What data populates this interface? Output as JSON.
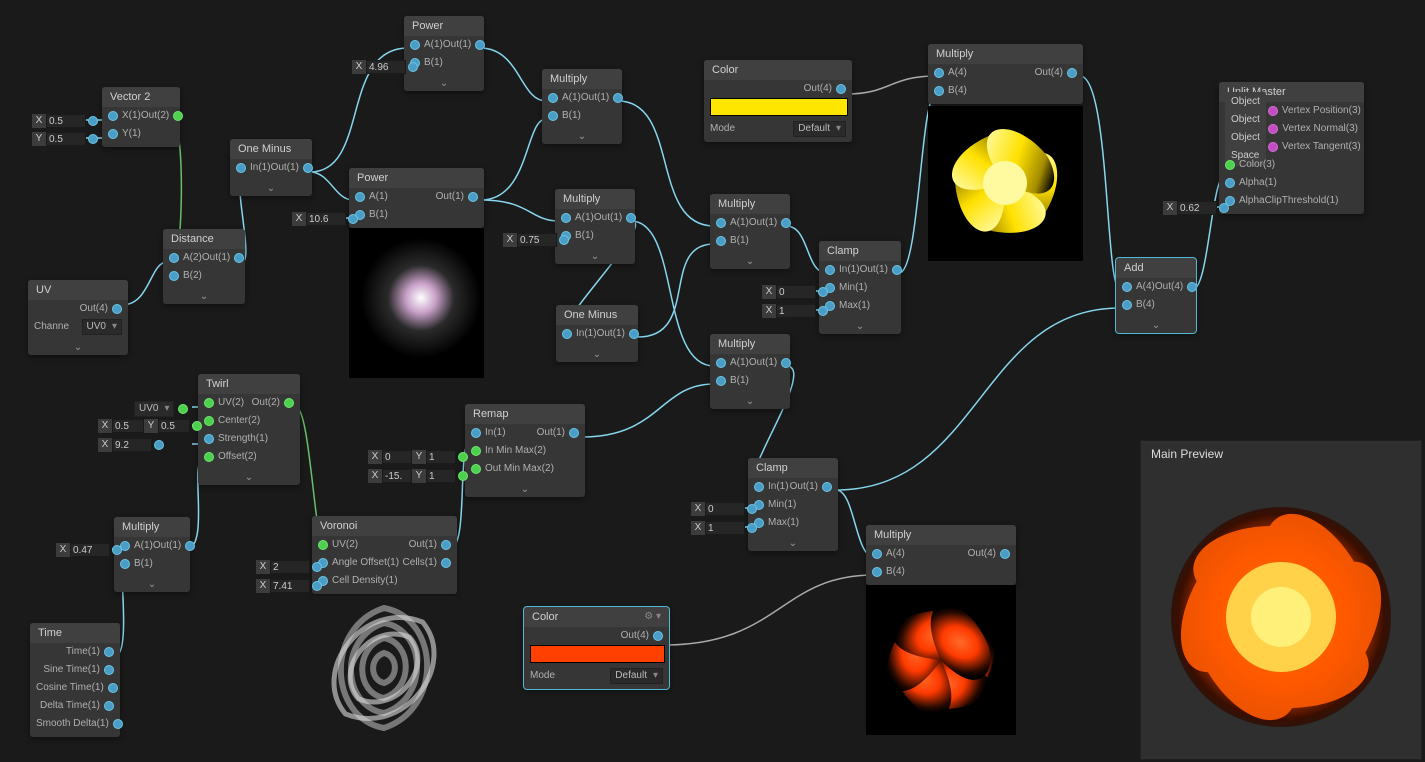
{
  "preview_title": "Main Preview",
  "master": {
    "title": "Unlit Master",
    "space": "Object Space",
    "ports": [
      "Vertex Position(3)",
      "Vertex Normal(3)",
      "Vertex Tangent(3)",
      "Color(3)",
      "Alpha(1)",
      "AlphaClipThreshold(1)"
    ],
    "alpha_x": "X",
    "alpha_val": "0.62"
  },
  "uv": {
    "title": "UV",
    "out": "Out(4)",
    "channel_lbl": "Channe",
    "channel": "UV0"
  },
  "vector2": {
    "title": "Vector 2",
    "x": "X(1)",
    "y": "Y(1)",
    "out": "Out(2)",
    "valx_lbl": "X",
    "valx": "0.5",
    "valy_lbl": "Y",
    "valy": "0.5"
  },
  "distance": {
    "title": "Distance",
    "a": "A(2)",
    "b": "B(2)",
    "out": "Out(1)"
  },
  "oneMinus": {
    "title": "One Minus",
    "in": "In(1)",
    "out": "Out(1)"
  },
  "power1": {
    "title": "Power",
    "a": "A(1)",
    "b": "B(1)",
    "out": "Out(1)",
    "bx": "X",
    "bval": "4.96"
  },
  "power2": {
    "title": "Power",
    "a": "A(1)",
    "b": "B(1)",
    "out": "Out(1)",
    "bx": "X",
    "bval": "10.6"
  },
  "mul_top": {
    "title": "Multiply",
    "a": "A(1)",
    "b": "B(1)",
    "out": "Out(1)"
  },
  "mul_mid": {
    "title": "Multiply",
    "a": "A(1)",
    "b": "B(1)",
    "out": "Out(1)",
    "bx": "X",
    "bval": "0.75"
  },
  "oneMinus2": {
    "title": "One Minus",
    "in": "In(1)",
    "out": "Out(1)"
  },
  "mul_r1": {
    "title": "Multiply",
    "a": "A(1)",
    "b": "B(1)",
    "out": "Out(1)"
  },
  "mul_r2": {
    "title": "Multiply",
    "a": "A(1)",
    "b": "B(1)",
    "out": "Out(1)"
  },
  "clamp1": {
    "title": "Clamp",
    "in": "In(1)",
    "min": "Min(1)",
    "max": "Max(1)",
    "out": "Out(1)",
    "minx": "X",
    "minval": "0",
    "maxx": "X",
    "maxval": "1"
  },
  "clamp2": {
    "title": "Clamp",
    "in": "In(1)",
    "min": "Min(1)",
    "max": "Max(1)",
    "out": "Out(1)",
    "minx": "X",
    "minval": "0",
    "maxx": "X",
    "maxval": "1"
  },
  "colorY": {
    "title": "Color",
    "out": "Out(4)",
    "mode_lbl": "Mode",
    "mode": "Default"
  },
  "colorO": {
    "title": "Color",
    "out": "Out(4)",
    "mode_lbl": "Mode",
    "mode": "Default"
  },
  "mulY": {
    "title": "Multiply",
    "a": "A(4)",
    "b": "B(4)",
    "out": "Out(4)"
  },
  "mulO": {
    "title": "Multiply",
    "a": "A(4)",
    "b": "B(4)",
    "out": "Out(4)"
  },
  "add": {
    "title": "Add",
    "a": "A(4)",
    "b": "B(4)",
    "out": "Out(4)"
  },
  "twirl": {
    "title": "Twirl",
    "uv": "UV(2)",
    "center": "Center(2)",
    "strength": "Strength(1)",
    "offset": "Offset(2)",
    "out": "Out(2)",
    "uv_sel": "UV0",
    "cx_lbl": "X",
    "cx": "0.5",
    "cy_lbl": "Y",
    "cy": "0.5",
    "sx_lbl": "X",
    "sx": "9.2"
  },
  "voronoi": {
    "title": "Voronoi",
    "uv": "UV(2)",
    "angle": "Angle Offset(1)",
    "dens": "Cell Density(1)",
    "out": "Out(1)",
    "cells": "Cells(1)",
    "ax_lbl": "X",
    "ax": "2",
    "dx_lbl": "X",
    "dx": "7.41"
  },
  "remap": {
    "title": "Remap",
    "in": "In(1)",
    "inmm": "In Min Max(2)",
    "outmm": "Out Min Max(2)",
    "out": "Out(1)",
    "in_x_lbl": "X",
    "in_x": "0",
    "in_y_lbl": "Y",
    "in_y": "1",
    "out_x_lbl": "X",
    "out_x": "-15.",
    "out_y_lbl": "Y",
    "out_y": "1"
  },
  "time": {
    "title": "Time",
    "t": "Time(1)",
    "sine": "Sine Time(1)",
    "cos": "Cosine Time(1)",
    "dt": "Delta Time(1)",
    "sdt": "Smooth Delta(1)"
  },
  "mulT": {
    "title": "Multiply",
    "a": "A(1)",
    "b": "B(1)",
    "out": "Out(1)",
    "ax_lbl": "X",
    "ax": "0.47"
  }
}
